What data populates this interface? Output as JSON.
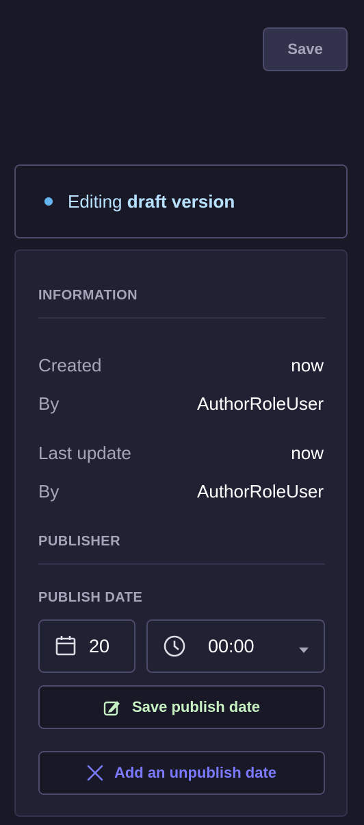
{
  "header": {
    "save_label": "Save"
  },
  "status": {
    "prefix": "Editing",
    "emphasis": "draft version"
  },
  "information": {
    "heading": "INFORMATION",
    "rows": [
      {
        "label": "Created",
        "value": "now"
      },
      {
        "label": "By",
        "value": "AuthorRoleUser"
      },
      {
        "label": "Last update",
        "value": "now"
      },
      {
        "label": "By",
        "value": "AuthorRoleUser"
      }
    ]
  },
  "publisher": {
    "heading": "PUBLISHER",
    "publish_date_label": "PUBLISH DATE",
    "date_value": "20",
    "time_value": "00:00",
    "save_publish_label": "Save publish date",
    "add_unpublish_label": "Add an unpublish date"
  },
  "colors": {
    "background": "#181826",
    "panel": "#212134",
    "border": "#4a4a6a",
    "accent_green": "#c6f0c2",
    "accent_purple": "#7b79ff",
    "status_dot": "#66b7f1"
  },
  "icons": {
    "date": "calendar-icon",
    "time": "clock-icon",
    "dropdown": "caret-down-icon",
    "save_publish": "pen-icon",
    "add_unpublish": "close-icon"
  }
}
